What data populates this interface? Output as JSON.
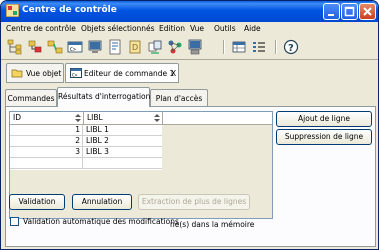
{
  "window": {
    "title": "Centre de contrôle"
  },
  "menu": [
    "Centre de contrôle",
    "Objets sélectionnés",
    "Edition",
    "Vue",
    "Outils",
    "Aide"
  ],
  "toolbar": {
    "icons": [
      "tree-icon",
      "object-icon",
      "connect-icon",
      "command-icon",
      "monitor-icon",
      "script-icon",
      "journal-icon",
      "replication-icon",
      "network-icon",
      "server-icon",
      "grid-view-icon",
      "list-view-icon",
      "help-icon"
    ]
  },
  "doc_tabs": [
    {
      "label": "Vue objet"
    },
    {
      "label": "Editeur de commande 1",
      "close": "X"
    }
  ],
  "sub_tabs": [
    "Commandes",
    "Résultats d'interrogation",
    "Plan d'accès"
  ],
  "grid": {
    "columns": [
      "ID",
      "LIBL"
    ],
    "rows": [
      {
        "id": "1",
        "libl": "LIBL 1"
      },
      {
        "id": "2",
        "libl": "LIBL 2"
      },
      {
        "id": "3",
        "libl": "LIBL 3"
      }
    ]
  },
  "buttons": {
    "add_row": "Ajout de ligne",
    "delete_row": "Suppression de ligne",
    "validate": "Validation",
    "cancel": "Annulation",
    "extract": "Extraction de plus de lignes"
  },
  "checkbox": {
    "label": "Validation automatique des modifications"
  },
  "memory_text": "ne(s) dans la mémoire"
}
